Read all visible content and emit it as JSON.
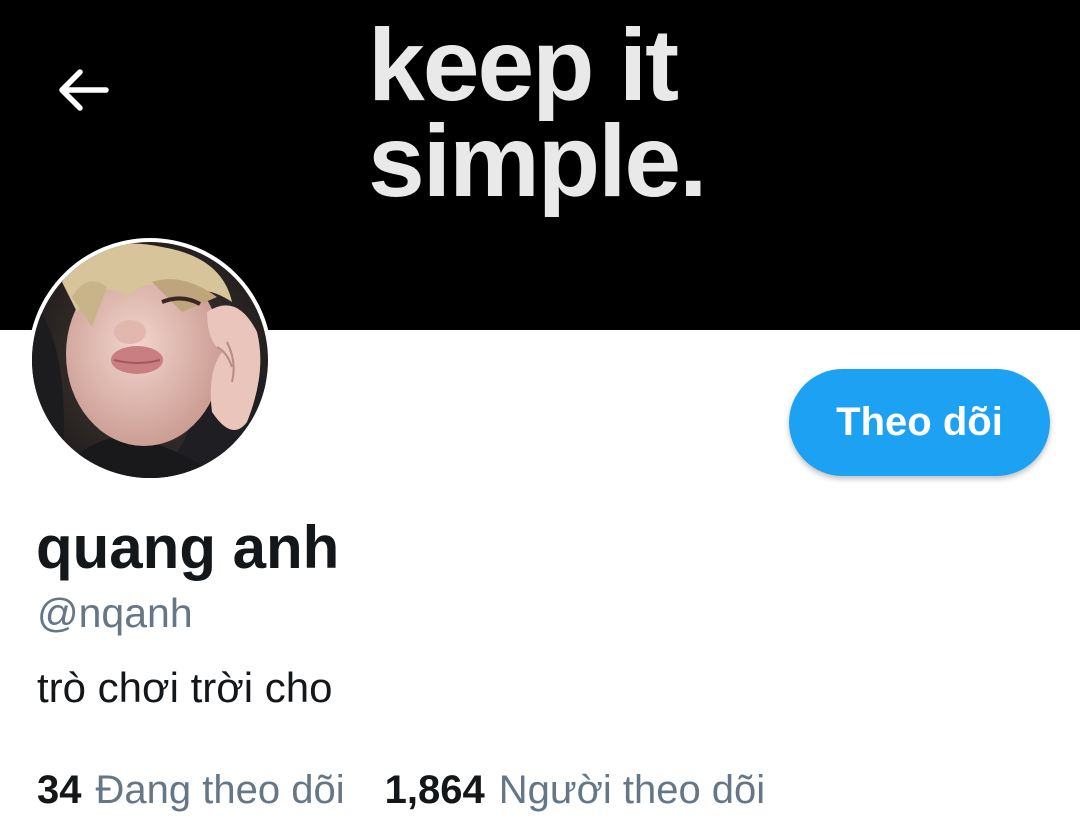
{
  "header": {
    "banner_text": {
      "line1": "keep it",
      "line2": "simple."
    },
    "back_icon": "arrow-left-icon"
  },
  "profile": {
    "display_name": "quang anh",
    "handle": "@nqanh",
    "bio": "trò chơi trời cho",
    "follow_label": "Theo dõi",
    "avatar": "profile-photo"
  },
  "stats": {
    "following_count": "34",
    "following_label": "Đang theo dõi",
    "followers_count": "1,864",
    "followers_label": "Người theo dõi"
  },
  "colors": {
    "accent": "#1da1f2",
    "banner_bg": "#000000",
    "banner_text": "#e9e9e9",
    "primary_text": "#14171a",
    "secondary_text": "#657786"
  }
}
